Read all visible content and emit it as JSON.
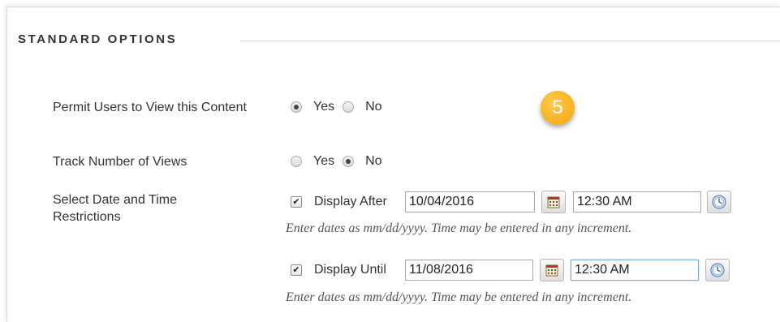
{
  "section": {
    "title": "STANDARD OPTIONS"
  },
  "step_badge": "5",
  "permit_users": {
    "label": "Permit Users to View this Content",
    "yes_label": "Yes",
    "no_label": "No",
    "selected": "Yes"
  },
  "track_views": {
    "label": "Track Number of Views",
    "yes_label": "Yes",
    "no_label": "No",
    "selected": "No"
  },
  "date_restrictions": {
    "label": "Select Date and Time Restrictions",
    "display_after": {
      "label": "Display After",
      "checked": true,
      "date": "10/04/2016",
      "time": "12:30 AM",
      "hint": "Enter dates as mm/dd/yyyy. Time may be entered in any increment."
    },
    "display_until": {
      "label": "Display Until",
      "checked": true,
      "date": "11/08/2016",
      "time": "12:30 AM",
      "hint": "Enter dates as mm/dd/yyyy. Time may be entered in any increment."
    }
  },
  "icons": {
    "calendar": "calendar-icon",
    "clock": "clock-icon",
    "check": "✔"
  },
  "colors": {
    "badge": "#f2a60a",
    "focus_border": "#7eaedb",
    "text": "#333333"
  }
}
